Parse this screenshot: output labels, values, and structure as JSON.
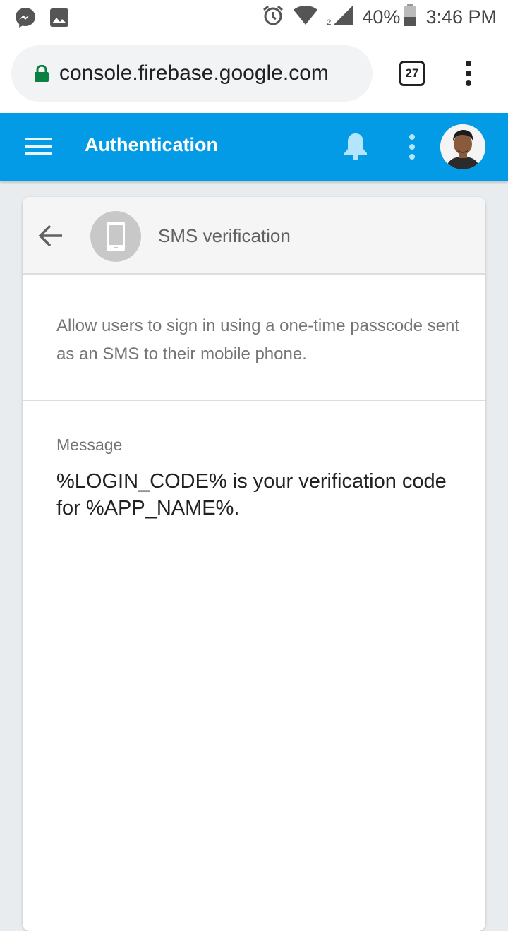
{
  "status_bar": {
    "battery": "40%",
    "time": "3:46 PM",
    "signal_sim": "2",
    "icons": [
      "messenger-icon",
      "image-icon",
      "alarm-icon",
      "wifi-icon",
      "signal-icon",
      "battery-icon"
    ]
  },
  "browser": {
    "url": "console.firebase.google.com",
    "tab_count": "27",
    "icons": [
      "lock-icon",
      "overflow-menu-icon"
    ]
  },
  "app_bar": {
    "title": "Authentication",
    "color": "#039be5",
    "icons": [
      "hamburger-menu-icon",
      "bell-icon",
      "more-vert-icon",
      "avatar"
    ]
  },
  "card": {
    "provider_title": "SMS verification",
    "provider_icon": "phone-icon",
    "description": "Allow users to sign in using a one-time passcode sent as an SMS to their mobile phone.",
    "message_label": "Message",
    "message_body": "%LOGIN_CODE% is your verification code for %APP_NAME%."
  }
}
